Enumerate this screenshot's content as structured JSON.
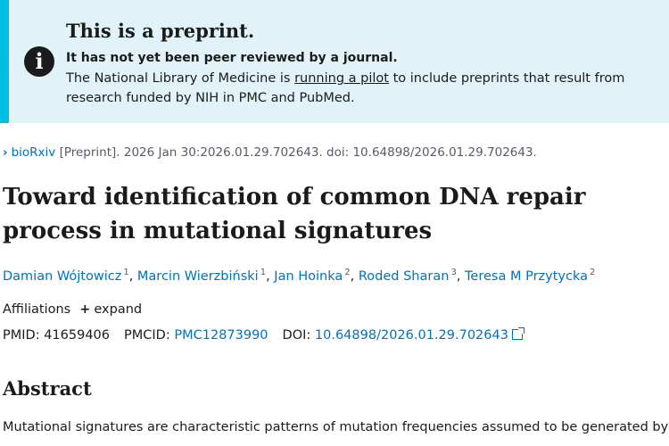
{
  "banner": {
    "title": "This is a preprint.",
    "subtitle": "It has not yet been peer reviewed by a journal.",
    "text_before": "The National Library of Medicine is ",
    "link": "running a pilot",
    "text_after": " to include preprints that result from research funded by NIH in PMC and PubMed.",
    "icon": "info-icon"
  },
  "breadcrumb": {
    "source": "bioRxiv",
    "detail": " [Preprint]. 2026 Jan 30:2026.01.29.702643. doi: 10.64898/2026.01.29.702643."
  },
  "article": {
    "title": "Toward identification of common DNA repair process in mutational signatures",
    "authors": [
      {
        "name": "Damian Wójtowicz",
        "aff": "1"
      },
      {
        "name": "Marcin Wierzbiński",
        "aff": "1"
      },
      {
        "name": "Jan Hoinka",
        "aff": "2"
      },
      {
        "name": "Roded Sharan",
        "aff": "3"
      },
      {
        "name": "Teresa M Przytycka",
        "aff": "2"
      }
    ],
    "affiliations_label": "Affiliations",
    "expand_label": "expand",
    "pmid_label": "PMID: ",
    "pmid": "41659406",
    "pmcid_label": "PMCID: ",
    "pmcid": "PMC12873990",
    "doi_label": "DOI: ",
    "doi": "10.64898/2026.01.29.702643"
  },
  "abstract": {
    "heading": "Abstract",
    "text": "Mutational signatures are characteristic patterns of mutation frequencies assumed to be generated by"
  },
  "colors": {
    "link": "#0071bc",
    "banner_bg": "#e1f3f8",
    "banner_border": "#00bde3"
  }
}
